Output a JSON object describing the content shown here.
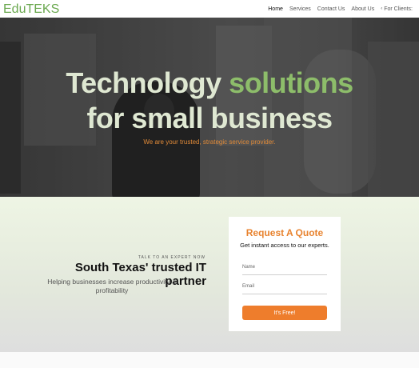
{
  "brand": {
    "logo_text": "EduTEKS",
    "logo_color": "#6aa84f"
  },
  "nav": {
    "items": [
      {
        "label": "Home",
        "active": true
      },
      {
        "label": "Services",
        "active": false
      },
      {
        "label": "Contact Us",
        "active": false
      },
      {
        "label": "About Us",
        "active": false
      }
    ],
    "clients_label": "For Clients:"
  },
  "hero": {
    "title_line1_plain": "Technology",
    "title_line1_accent": "solutions",
    "title_line2": "for small business",
    "subtitle": "We are your trusted, strategic service provider.",
    "title_color": "#dfe8d2",
    "accent_color": "#8dbd6a",
    "subtitle_color": "#e08a38"
  },
  "expert": {
    "eyebrow": "TALK TO AN EXPERT NOW",
    "tagline": "South Texas' trusted IT partner",
    "description": "Helping businesses increase productivity & profitability"
  },
  "quote_form": {
    "title": "Request A Quote",
    "subtitle": "Get instant access to our experts.",
    "name_placeholder": "Name",
    "email_placeholder": "Email",
    "button_label": "It's Free!",
    "button_color": "#ee7d2c"
  }
}
